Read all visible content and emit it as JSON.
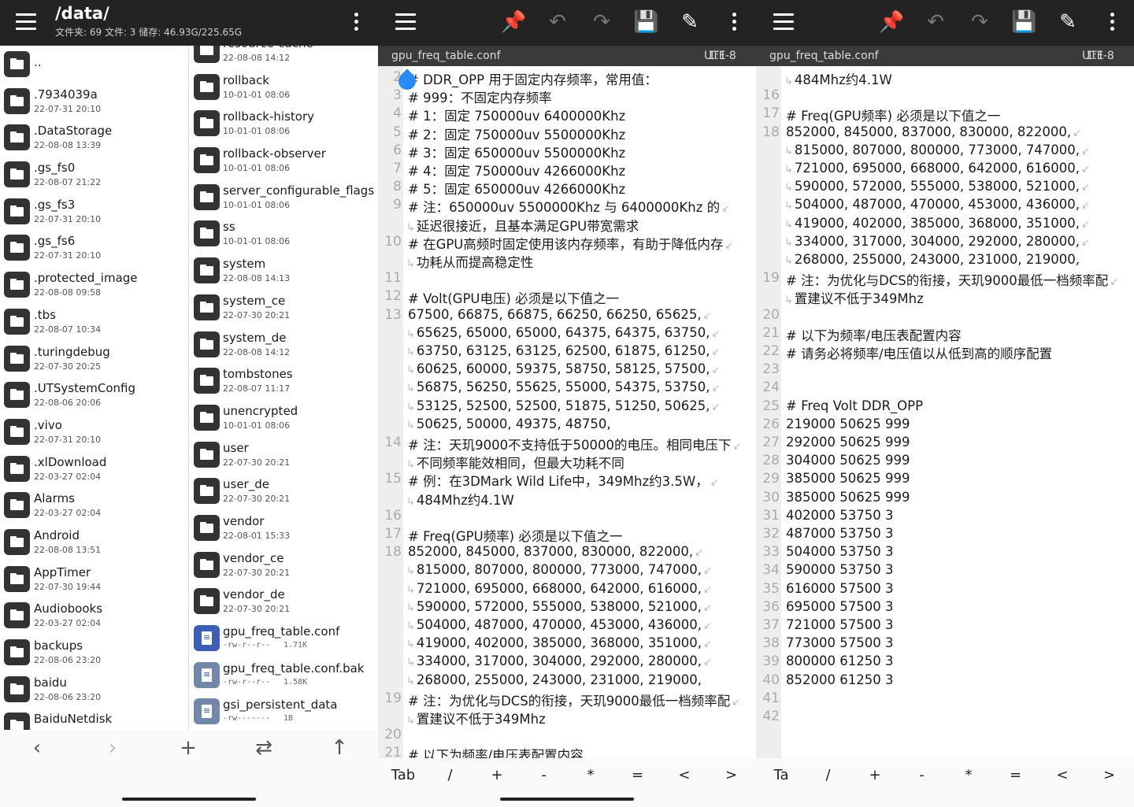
{
  "file_manager": {
    "path": "/data/",
    "info": "文件夹: 69  文件: 3  储存: 46.93G/225.65G",
    "left_list": [
      {
        "name": "..",
        "date": ""
      },
      {
        "name": ".7934039a",
        "date": "22-07-31 20:10"
      },
      {
        "name": ".DataStorage",
        "date": "22-08-08 13:39"
      },
      {
        "name": ".gs_fs0",
        "date": "22-08-07 21:22"
      },
      {
        "name": ".gs_fs3",
        "date": "22-07-31 20:10"
      },
      {
        "name": ".gs_fs6",
        "date": "22-07-31 20:10"
      },
      {
        "name": ".protected_image",
        "date": "22-08-08 09:58"
      },
      {
        "name": ".tbs",
        "date": "22-08-07 10:34"
      },
      {
        "name": ".turingdebug",
        "date": "22-07-30 20:25"
      },
      {
        "name": ".UTSystemConfig",
        "date": "22-08-06 20:06"
      },
      {
        "name": ".vivo",
        "date": "22-07-31 20:10"
      },
      {
        "name": ".xlDownload",
        "date": "22-03-27 02:04"
      },
      {
        "name": "Alarms",
        "date": "22-03-27 02:04"
      },
      {
        "name": "Android",
        "date": "22-08-08 13:51"
      },
      {
        "name": "AppTimer",
        "date": "22-07-30 19:44"
      },
      {
        "name": "Audiobooks",
        "date": "22-03-27 02:04"
      },
      {
        "name": "backups",
        "date": "22-08-06 23:20"
      },
      {
        "name": "baidu",
        "date": "22-08-06 23:20"
      },
      {
        "name": "BaiduNetdisk",
        "date": ""
      }
    ],
    "right_list": [
      {
        "name": "resource-cache",
        "date": "22-08-08 14:12",
        "type": "folder"
      },
      {
        "name": "rollback",
        "date": "10-01-01 08:06",
        "type": "folder"
      },
      {
        "name": "rollback-history",
        "date": "10-01-01 08:06",
        "type": "folder"
      },
      {
        "name": "rollback-observer",
        "date": "10-01-01 08:06",
        "type": "folder"
      },
      {
        "name": "server_configurable_flags",
        "date": "10-01-01 08:06",
        "type": "folder"
      },
      {
        "name": "ss",
        "date": "10-01-01 08:06",
        "type": "folder"
      },
      {
        "name": "system",
        "date": "22-08-08 14:13",
        "type": "folder"
      },
      {
        "name": "system_ce",
        "date": "22-07-30 20:21",
        "type": "folder"
      },
      {
        "name": "system_de",
        "date": "22-08-08 14:12",
        "type": "folder"
      },
      {
        "name": "tombstones",
        "date": "22-08-07 11:17",
        "type": "folder"
      },
      {
        "name": "unencrypted",
        "date": "10-01-01 08:06",
        "type": "folder"
      },
      {
        "name": "user",
        "date": "22-07-30 20:21",
        "type": "folder"
      },
      {
        "name": "user_de",
        "date": "22-07-30 20:21",
        "type": "folder"
      },
      {
        "name": "vendor",
        "date": "22-08-01 15:33",
        "type": "folder"
      },
      {
        "name": "vendor_ce",
        "date": "22-07-30 20:21",
        "type": "folder"
      },
      {
        "name": "vendor_de",
        "date": "22-07-30 20:21",
        "type": "folder"
      },
      {
        "name": "gpu_freq_table.conf",
        "perm": "-rw-r--r--",
        "size": "1.71K",
        "type": "file-active"
      },
      {
        "name": "gpu_freq_table.conf.bak",
        "perm": "-rw-r--r--",
        "size": "1.58K",
        "type": "file"
      },
      {
        "name": "gsi_persistent_data",
        "perm": "-rw-------",
        "size": "1B",
        "type": "file"
      }
    ],
    "bottom_nav": {
      "back": "‹",
      "forward": "›",
      "add": "+",
      "swap": "⇄",
      "up": "↑"
    }
  },
  "editor1": {
    "filename": "gpu_freq_table.conf",
    "cursor": "1:1",
    "encoding": "UTF-8",
    "lines": [
      {
        "n": "2",
        "t": "# DDR_OPP 用于固定内存频率，常用值：",
        "cont": false,
        "wrapend": false
      },
      {
        "n": "3",
        "t": "# 999：不固定内存频率",
        "cont": false,
        "wrapend": false
      },
      {
        "n": "4",
        "t": "# 1：固定 750000uv 6400000Khz",
        "cont": false,
        "wrapend": false
      },
      {
        "n": "5",
        "t": "# 2：固定 750000uv 5500000Khz",
        "cont": false,
        "wrapend": false
      },
      {
        "n": "6",
        "t": "# 3：固定 650000uv 5500000Khz",
        "cont": false,
        "wrapend": false
      },
      {
        "n": "7",
        "t": "# 4：固定 750000uv 4266000Khz",
        "cont": false,
        "wrapend": false
      },
      {
        "n": "8",
        "t": "# 5：固定 650000uv 4266000Khz",
        "cont": false,
        "wrapend": false
      },
      {
        "n": "9",
        "t": "# 注：650000uv 5500000Khz 与 6400000Khz 的",
        "cont": false,
        "wrapend": true
      },
      {
        "n": "",
        "t": "延迟很接近，且基本满足GPU带宽需求",
        "cont": true,
        "wrapend": false
      },
      {
        "n": "10",
        "t": "# 在GPU高频时固定使用该内存频率，有助于降低内存",
        "cont": false,
        "wrapend": true
      },
      {
        "n": "",
        "t": "功耗从而提高稳定性",
        "cont": true,
        "wrapend": false
      },
      {
        "n": "11",
        "t": "",
        "cont": false,
        "wrapend": false
      },
      {
        "n": "12",
        "t": "# Volt(GPU电压) 必须是以下值之一",
        "cont": false,
        "wrapend": false
      },
      {
        "n": "13",
        "t": "67500, 66875, 66875, 66250, 66250, 65625,",
        "cont": false,
        "wrapend": true
      },
      {
        "n": "",
        "t": "65625, 65000, 65000, 64375, 64375, 63750,",
        "cont": true,
        "wrapend": true
      },
      {
        "n": "",
        "t": "63750, 63125, 63125, 62500, 61875, 61250,",
        "cont": true,
        "wrapend": true
      },
      {
        "n": "",
        "t": "60625, 60000, 59375, 58750, 58125, 57500,",
        "cont": true,
        "wrapend": true
      },
      {
        "n": "",
        "t": "56875, 56250, 55625, 55000, 54375, 53750,",
        "cont": true,
        "wrapend": true
      },
      {
        "n": "",
        "t": "53125, 52500, 52500, 51875, 51250, 50625,",
        "cont": true,
        "wrapend": true
      },
      {
        "n": "",
        "t": "50625, 50000, 49375, 48750,",
        "cont": true,
        "wrapend": false
      },
      {
        "n": "14",
        "t": "# 注：天玑9000不支持低于50000的电压。相同电压下",
        "cont": false,
        "wrapend": true
      },
      {
        "n": "",
        "t": "不同频率能效相同，但最大功耗不同",
        "cont": true,
        "wrapend": false
      },
      {
        "n": "15",
        "t": "# 例：在3DMark Wild Life中，349Mhz约3.5W，",
        "cont": false,
        "wrapend": true
      },
      {
        "n": "",
        "t": "484Mhz约4.1W",
        "cont": true,
        "wrapend": false
      },
      {
        "n": "16",
        "t": "",
        "cont": false,
        "wrapend": false
      },
      {
        "n": "17",
        "t": "# Freq(GPU频率) 必须是以下值之一",
        "cont": false,
        "wrapend": false
      },
      {
        "n": "18",
        "t": "852000, 845000, 837000, 830000, 822000,",
        "cont": false,
        "wrapend": true
      },
      {
        "n": "",
        "t": "815000, 807000, 800000, 773000, 747000,",
        "cont": true,
        "wrapend": true
      },
      {
        "n": "",
        "t": "721000, 695000, 668000, 642000, 616000,",
        "cont": true,
        "wrapend": true
      },
      {
        "n": "",
        "t": "590000, 572000, 555000, 538000, 521000,",
        "cont": true,
        "wrapend": true
      },
      {
        "n": "",
        "t": "504000, 487000, 470000, 453000, 436000,",
        "cont": true,
        "wrapend": true
      },
      {
        "n": "",
        "t": "419000, 402000, 385000, 368000, 351000,",
        "cont": true,
        "wrapend": true
      },
      {
        "n": "",
        "t": "334000, 317000, 304000, 292000, 280000,",
        "cont": true,
        "wrapend": true
      },
      {
        "n": "",
        "t": "268000, 255000, 243000, 231000, 219000,",
        "cont": true,
        "wrapend": false
      },
      {
        "n": "19",
        "t": "# 注：为优化与DCS的衔接，天玑9000最低一档频率配",
        "cont": false,
        "wrapend": true
      },
      {
        "n": "",
        "t": "置建议不低于349Mhz",
        "cont": true,
        "wrapend": false
      },
      {
        "n": "20",
        "t": "",
        "cont": false,
        "wrapend": false
      },
      {
        "n": "21",
        "t": "# 以下为频率/电压表配置内容",
        "cont": false,
        "wrapend": false
      }
    ]
  },
  "editor2": {
    "filename": "gpu_freq_table.conf",
    "cursor": "1:1",
    "encoding": "UTF-8",
    "lines": [
      {
        "n": "",
        "t": "484Mhz约4.1W",
        "cont": true,
        "wrapend": false
      },
      {
        "n": "16",
        "t": "",
        "cont": false,
        "wrapend": false
      },
      {
        "n": "17",
        "t": "# Freq(GPU频率) 必须是以下值之一",
        "cont": false,
        "wrapend": false
      },
      {
        "n": "18",
        "t": "852000, 845000, 837000, 830000, 822000,",
        "cont": false,
        "wrapend": true
      },
      {
        "n": "",
        "t": "815000, 807000, 800000, 773000, 747000,",
        "cont": true,
        "wrapend": true
      },
      {
        "n": "",
        "t": "721000, 695000, 668000, 642000, 616000,",
        "cont": true,
        "wrapend": true
      },
      {
        "n": "",
        "t": "590000, 572000, 555000, 538000, 521000,",
        "cont": true,
        "wrapend": true
      },
      {
        "n": "",
        "t": "504000, 487000, 470000, 453000, 436000,",
        "cont": true,
        "wrapend": true
      },
      {
        "n": "",
        "t": "419000, 402000, 385000, 368000, 351000,",
        "cont": true,
        "wrapend": true
      },
      {
        "n": "",
        "t": "334000, 317000, 304000, 292000, 280000,",
        "cont": true,
        "wrapend": true
      },
      {
        "n": "",
        "t": "268000, 255000, 243000, 231000, 219000,",
        "cont": true,
        "wrapend": false
      },
      {
        "n": "19",
        "t": "# 注：为优化与DCS的衔接，天玑9000最低一档频率配",
        "cont": false,
        "wrapend": true
      },
      {
        "n": "",
        "t": "置建议不低于349Mhz",
        "cont": true,
        "wrapend": false
      },
      {
        "n": "20",
        "t": "",
        "cont": false,
        "wrapend": false
      },
      {
        "n": "21",
        "t": "# 以下为频率/电压表配置内容",
        "cont": false,
        "wrapend": false
      },
      {
        "n": "22",
        "t": "# 请务必将频率/电压值以从低到高的顺序配置",
        "cont": false,
        "wrapend": false
      },
      {
        "n": "23",
        "t": "",
        "cont": false,
        "wrapend": false
      },
      {
        "n": "24",
        "t": "",
        "cont": false,
        "wrapend": false
      },
      {
        "n": "25",
        "t": "# Freq Volt DDR_OPP",
        "cont": false,
        "wrapend": false
      },
      {
        "n": "26",
        "t": "219000 50625 999",
        "cont": false,
        "wrapend": false
      },
      {
        "n": "27",
        "t": "292000 50625 999",
        "cont": false,
        "wrapend": false
      },
      {
        "n": "28",
        "t": "304000 50625 999",
        "cont": false,
        "wrapend": false
      },
      {
        "n": "29",
        "t": "385000 50625 999",
        "cont": false,
        "wrapend": false
      },
      {
        "n": "30",
        "t": "385000 50625 999",
        "cont": false,
        "wrapend": false
      },
      {
        "n": "31",
        "t": "402000 53750 3",
        "cont": false,
        "wrapend": false
      },
      {
        "n": "32",
        "t": "487000 53750 3",
        "cont": false,
        "wrapend": false
      },
      {
        "n": "33",
        "t": "504000 53750 3",
        "cont": false,
        "wrapend": false
      },
      {
        "n": "34",
        "t": "590000 53750 3",
        "cont": false,
        "wrapend": false
      },
      {
        "n": "35",
        "t": "616000 57500 3",
        "cont": false,
        "wrapend": false
      },
      {
        "n": "36",
        "t": "695000 57500 3",
        "cont": false,
        "wrapend": false
      },
      {
        "n": "37",
        "t": "721000 57500 3",
        "cont": false,
        "wrapend": false
      },
      {
        "n": "38",
        "t": "773000 57500 3",
        "cont": false,
        "wrapend": false
      },
      {
        "n": "39",
        "t": "800000 61250 3",
        "cont": false,
        "wrapend": false
      },
      {
        "n": "40",
        "t": "852000 61250 3",
        "cont": false,
        "wrapend": false
      },
      {
        "n": "41",
        "t": "",
        "cont": false,
        "wrapend": false
      },
      {
        "n": "42",
        "t": "",
        "cont": false,
        "wrapend": false
      }
    ]
  },
  "keyboard_bar_1": [
    "Tab",
    "/",
    "+",
    "-",
    "*",
    "=",
    "<",
    ">"
  ],
  "keyboard_bar_2": [
    "Ta",
    "/",
    "+",
    "-",
    "*",
    "=",
    "<",
    ">"
  ],
  "colors": {
    "toolbar_bg": "#232323",
    "accent": "#3b5fb5",
    "cursor_marker": "#2a8af6"
  }
}
